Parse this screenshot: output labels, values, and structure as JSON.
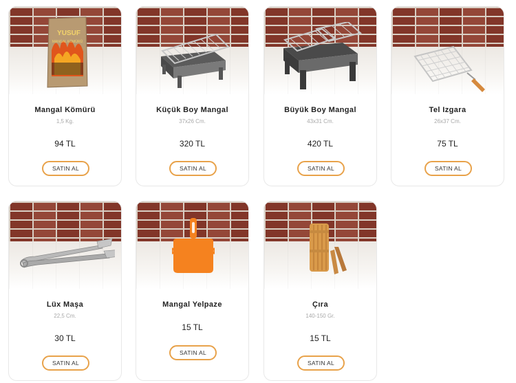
{
  "products": [
    {
      "name": "Mangal Kömürü",
      "size": "1,5 Kg.",
      "price": "94 TL",
      "button": "SATIN AL",
      "image_icon": "charcoal-bag-icon",
      "package_text": "YUSUF",
      "package_subtext": "MANGAL KÖMÜRÜ"
    },
    {
      "name": "Küçük Boy Mangal",
      "size": "37x26 Cm.",
      "price": "320 TL",
      "button": "SATIN AL",
      "image_icon": "small-grill-icon"
    },
    {
      "name": "Büyük Boy Mangal",
      "size": "43x31 Cm.",
      "price": "420 TL",
      "button": "SATIN AL",
      "image_icon": "large-grill-icon"
    },
    {
      "name": "Tel Izgara",
      "size": "26x37 Cm.",
      "price": "75 TL",
      "button": "SATIN AL",
      "image_icon": "wire-grill-icon"
    },
    {
      "name": "Lüx Maşa",
      "size": "22,5 Cm.",
      "price": "30 TL",
      "button": "SATIN AL",
      "image_icon": "tongs-icon"
    },
    {
      "name": "Mangal Yelpaze",
      "size": "",
      "price": "15 TL",
      "button": "SATIN AL",
      "image_icon": "fan-icon"
    },
    {
      "name": "Çıra",
      "size": "140-150 Gr.",
      "price": "15 TL",
      "button": "SATIN AL",
      "image_icon": "kindling-icon"
    }
  ],
  "colors": {
    "button_border": "#e8a24a",
    "fan": "#f5821f",
    "brick": "#8d3b2c"
  }
}
